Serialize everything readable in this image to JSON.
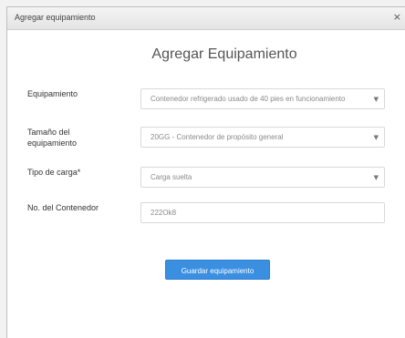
{
  "dialog": {
    "window_title": "Agregar equipamiento",
    "close_glyph": "×",
    "heading": "Agregar Equipamiento"
  },
  "form": {
    "equipamiento": {
      "label": "Equipamiento",
      "value": "Contenedor refrigerado usado de 40 pies en funcionamiento"
    },
    "tamano": {
      "label": "Tamaño del equipamiento",
      "value": "20GG - Contenedor de propósito general"
    },
    "tipo_carga": {
      "label": "Tipo de carga*",
      "value": "Carga suelta"
    },
    "contenedor": {
      "label": "No. del Contenedor",
      "value": "222Ok8"
    }
  },
  "actions": {
    "submit_label": "Guardar equipamiento"
  },
  "icons": {
    "caret": "▼"
  },
  "colors": {
    "accent": "#3a8fe0"
  }
}
